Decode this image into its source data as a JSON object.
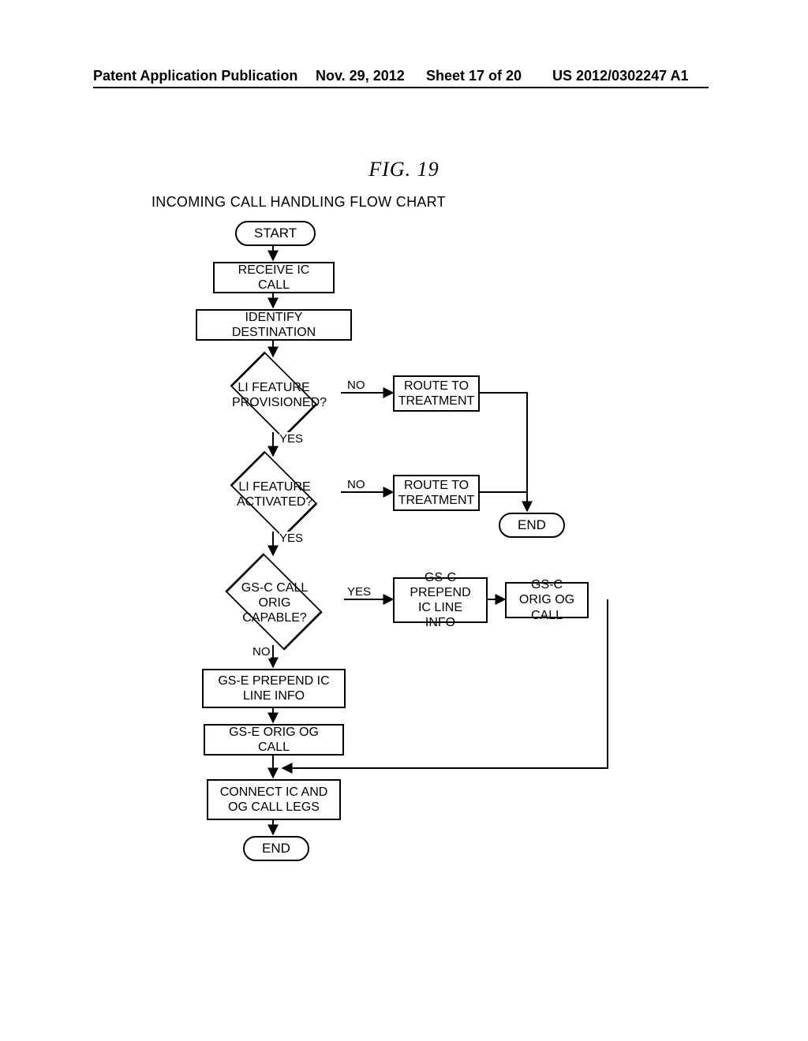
{
  "header": {
    "left": "Patent Application Publication",
    "center_date": "Nov. 29, 2012",
    "center_sheet": "Sheet 17 of 20",
    "right": "US 2012/0302247 A1"
  },
  "figure": {
    "label": "FIG. 19"
  },
  "subtitle": "INCOMING CALL HANDLING FLOW CHART",
  "nodes": {
    "start": "START",
    "receive": "RECEIVE IC CALL",
    "identify": "IDENTIFY DESTINATION",
    "d1": "LI FEATURE PROVISIONED?",
    "route1": "ROUTE TO TREATMENT",
    "d2": "LI FEATURE ACTIVATED?",
    "route2": "ROUTE TO TREATMENT",
    "end1": "END",
    "d3": "GS-C CALL ORIG CAPABLE?",
    "gsc_prepend": "GS-C PREPEND IC LINE INFO",
    "gsc_orig": "GS-C ORIG OG CALL",
    "gse_prepend": "GS-E PREPEND IC LINE INFO",
    "gse_orig": "GS-E ORIG OG CALL",
    "connect": "CONNECT IC AND OG CALL LEGS",
    "end2": "END"
  },
  "edges": {
    "no": "NO",
    "yes": "YES"
  },
  "chart_data": {
    "type": "flowchart",
    "nodes": [
      {
        "id": "start",
        "kind": "terminator",
        "label": "START"
      },
      {
        "id": "receive",
        "kind": "process",
        "label": "RECEIVE IC CALL"
      },
      {
        "id": "identify",
        "kind": "process",
        "label": "IDENTIFY DESTINATION"
      },
      {
        "id": "d1",
        "kind": "decision",
        "label": "LI FEATURE PROVISIONED?"
      },
      {
        "id": "route1",
        "kind": "process",
        "label": "ROUTE TO TREATMENT"
      },
      {
        "id": "d2",
        "kind": "decision",
        "label": "LI FEATURE ACTIVATED?"
      },
      {
        "id": "route2",
        "kind": "process",
        "label": "ROUTE TO TREATMENT"
      },
      {
        "id": "end1",
        "kind": "terminator",
        "label": "END"
      },
      {
        "id": "d3",
        "kind": "decision",
        "label": "GS-C CALL ORIG CAPABLE?"
      },
      {
        "id": "gsc_prepend",
        "kind": "process",
        "label": "GS-C PREPEND IC LINE INFO"
      },
      {
        "id": "gsc_orig",
        "kind": "process",
        "label": "GS-C ORIG OG CALL"
      },
      {
        "id": "gse_prepend",
        "kind": "process",
        "label": "GS-E PREPEND IC LINE INFO"
      },
      {
        "id": "gse_orig",
        "kind": "process",
        "label": "GS-E ORIG OG CALL"
      },
      {
        "id": "connect",
        "kind": "process",
        "label": "CONNECT IC AND OG CALL LEGS"
      },
      {
        "id": "end2",
        "kind": "terminator",
        "label": "END"
      }
    ],
    "edges": [
      {
        "from": "start",
        "to": "receive"
      },
      {
        "from": "receive",
        "to": "identify"
      },
      {
        "from": "identify",
        "to": "d1"
      },
      {
        "from": "d1",
        "to": "route1",
        "label": "NO"
      },
      {
        "from": "d1",
        "to": "d2",
        "label": "YES"
      },
      {
        "from": "d2",
        "to": "route2",
        "label": "NO"
      },
      {
        "from": "d2",
        "to": "d3",
        "label": "YES"
      },
      {
        "from": "route1",
        "to": "end1"
      },
      {
        "from": "route2",
        "to": "end1"
      },
      {
        "from": "d3",
        "to": "gsc_prepend",
        "label": "YES"
      },
      {
        "from": "gsc_prepend",
        "to": "gsc_orig"
      },
      {
        "from": "d3",
        "to": "gse_prepend",
        "label": "NO"
      },
      {
        "from": "gse_prepend",
        "to": "gse_orig"
      },
      {
        "from": "gse_orig",
        "to": "connect"
      },
      {
        "from": "gsc_orig",
        "to": "connect"
      },
      {
        "from": "connect",
        "to": "end2"
      }
    ]
  }
}
